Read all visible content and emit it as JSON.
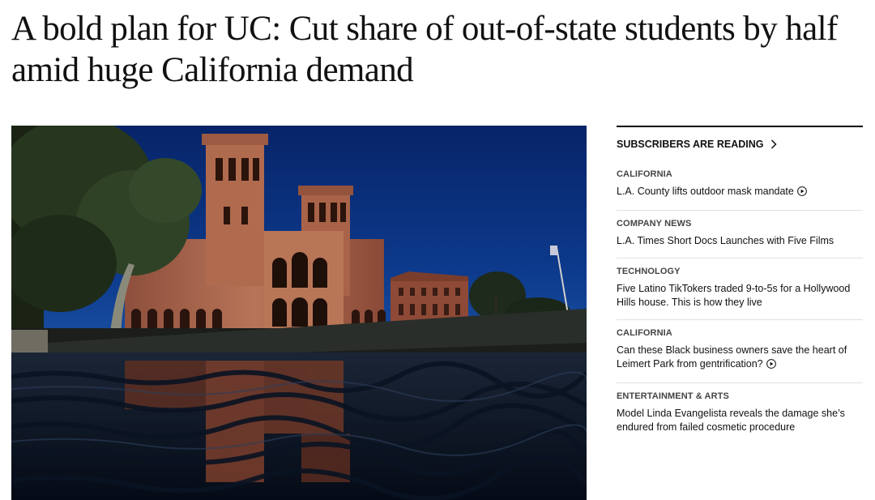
{
  "article": {
    "headline": "A bold plan for UC: Cut share of out-of-state students by half amid huge California demand"
  },
  "hero_image": {
    "alt": "Royce Hall reflected in a pool"
  },
  "rail": {
    "header": "SUBSCRIBERS ARE READING",
    "header_icon": "chevron-right-icon",
    "stories": [
      {
        "kicker": "CALIFORNIA",
        "title": "L.A. County lifts outdoor mask mandate",
        "video": true
      },
      {
        "kicker": "COMPANY NEWS",
        "title": "L.A. Times Short Docs Launches with Five Films",
        "video": false
      },
      {
        "kicker": "TECHNOLOGY",
        "title": "Five Latino TikTokers traded 9-to-5s for a Hollywood Hills house. This is how they live",
        "video": false
      },
      {
        "kicker": "CALIFORNIA",
        "title": "Can these Black business owners save the heart of Leimert Park from gentrification?",
        "video": true
      },
      {
        "kicker": "ENTERTAINMENT & ARTS",
        "title": "Model Linda Evangelista reveals the damage she’s endured from failed cosmetic procedure",
        "video": false
      }
    ]
  },
  "colors": {
    "sky": "#0b2f7a",
    "brick": "#a0614a",
    "water": "#0a1a2e",
    "rule": "#000000",
    "divider": "#e2e2e2"
  }
}
